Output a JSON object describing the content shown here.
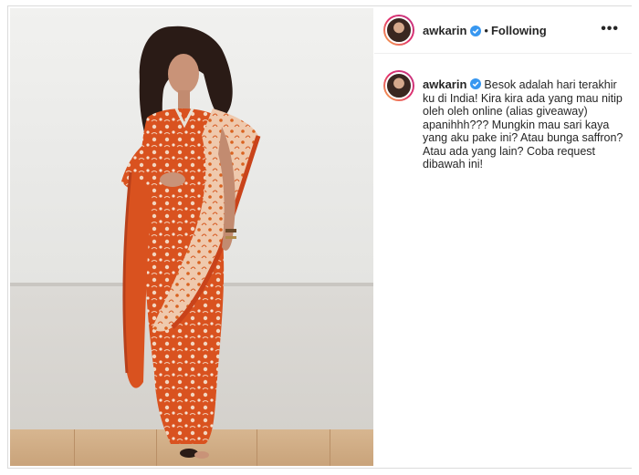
{
  "header": {
    "username": "awkarin",
    "separator": "•",
    "follow_status": "Following",
    "more_icon": "ellipsis-icon"
  },
  "caption": {
    "username": "awkarin",
    "text": "Besok adalah hari terakhir ku di India! Kira kira ada yang mau nitip oleh oleh online (alias giveaway) apanihhh??? Mungkin mau sari kaya yang aku pake ini? Atau bunga saffron? Atau ada yang lain? Coba request dibawah ini!"
  },
  "colors": {
    "verified_badge": "#3897f0",
    "text": "#262626",
    "saree": "#d9521f"
  }
}
